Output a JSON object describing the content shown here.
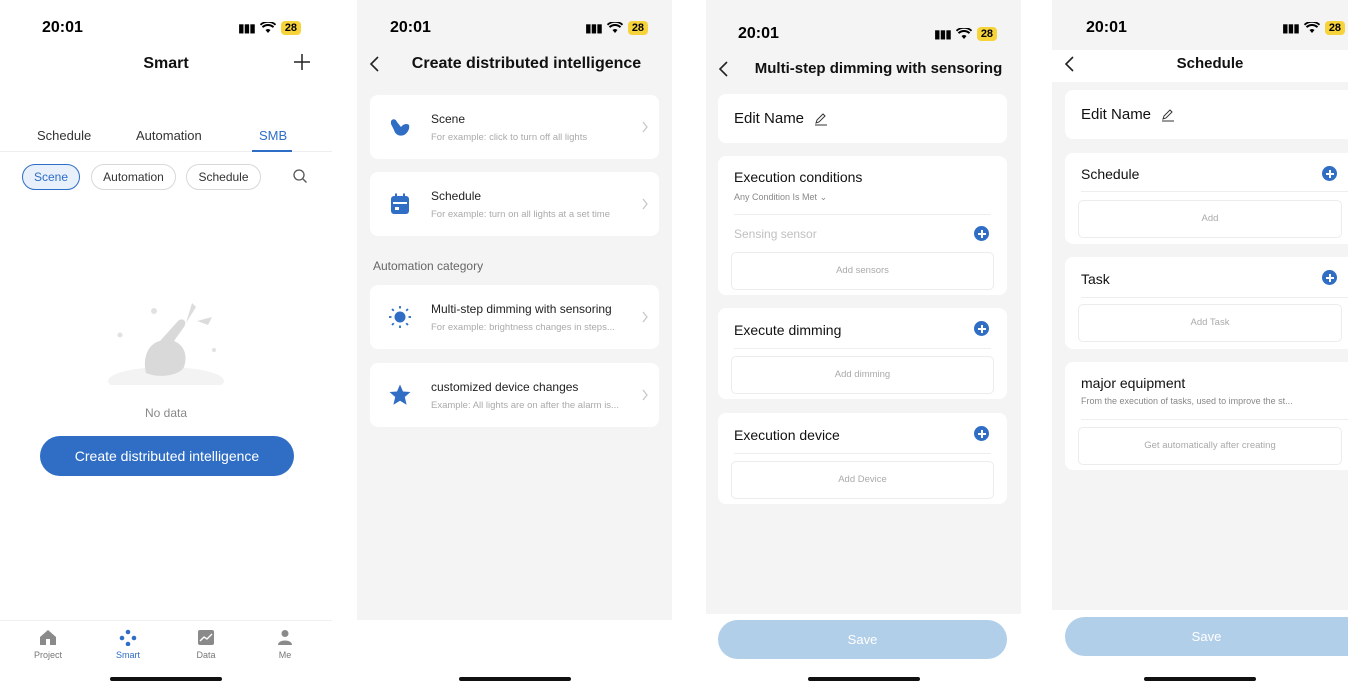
{
  "status": {
    "time": "20:01",
    "battery": "28"
  },
  "screen1": {
    "title": "Smart",
    "tabs": [
      "Schedule",
      "Automation",
      "SMB"
    ],
    "chips": [
      "Scene",
      "Automation",
      "Schedule"
    ],
    "empty_text": "No data",
    "create_button": "Create distributed intelligence",
    "nav": [
      "Project",
      "Smart",
      "Data",
      "Me"
    ]
  },
  "screen2": {
    "title": "Create distributed intelligence",
    "options": [
      {
        "title": "Scene",
        "desc": "For example: click to turn off all lights",
        "icon": "hand-icon"
      },
      {
        "title": "Schedule",
        "desc": "For example: turn on all lights at a set time",
        "icon": "calendar-icon"
      }
    ],
    "category_label": "Automation category",
    "automation_options": [
      {
        "title": "Multi-step dimming with sensoring",
        "desc": "For example: brightness changes in steps...",
        "icon": "sun-icon"
      },
      {
        "title": "customized device changes",
        "desc": "Example: All lights are on after the alarm is...",
        "icon": "star-icon"
      }
    ]
  },
  "screen3": {
    "title": "Multi-step dimming with sensoring",
    "edit_name": "Edit Name",
    "conditions_title": "Execution conditions",
    "conditions_sub": "Any Condition Is Met",
    "sensor_placeholder": "Sensing sensor",
    "add_sensors": "Add sensors",
    "dimming_title": "Execute dimming",
    "add_dimming": "Add dimming",
    "device_title": "Execution device",
    "add_device": "Add Device",
    "save": "Save"
  },
  "screen4": {
    "title": "Schedule",
    "edit_name": "Edit Name",
    "schedule_title": "Schedule",
    "add": "Add",
    "task_title": "Task",
    "add_task": "Add Task",
    "equipment_title": "major equipment",
    "equipment_desc": "From the execution of tasks, used to improve the st...",
    "equipment_auto": "Get automatically after creating",
    "save": "Save"
  },
  "colors": {
    "accent": "#2f6ec4",
    "save_disabled": "#b2cfe9",
    "battery": "#f7d33b"
  }
}
